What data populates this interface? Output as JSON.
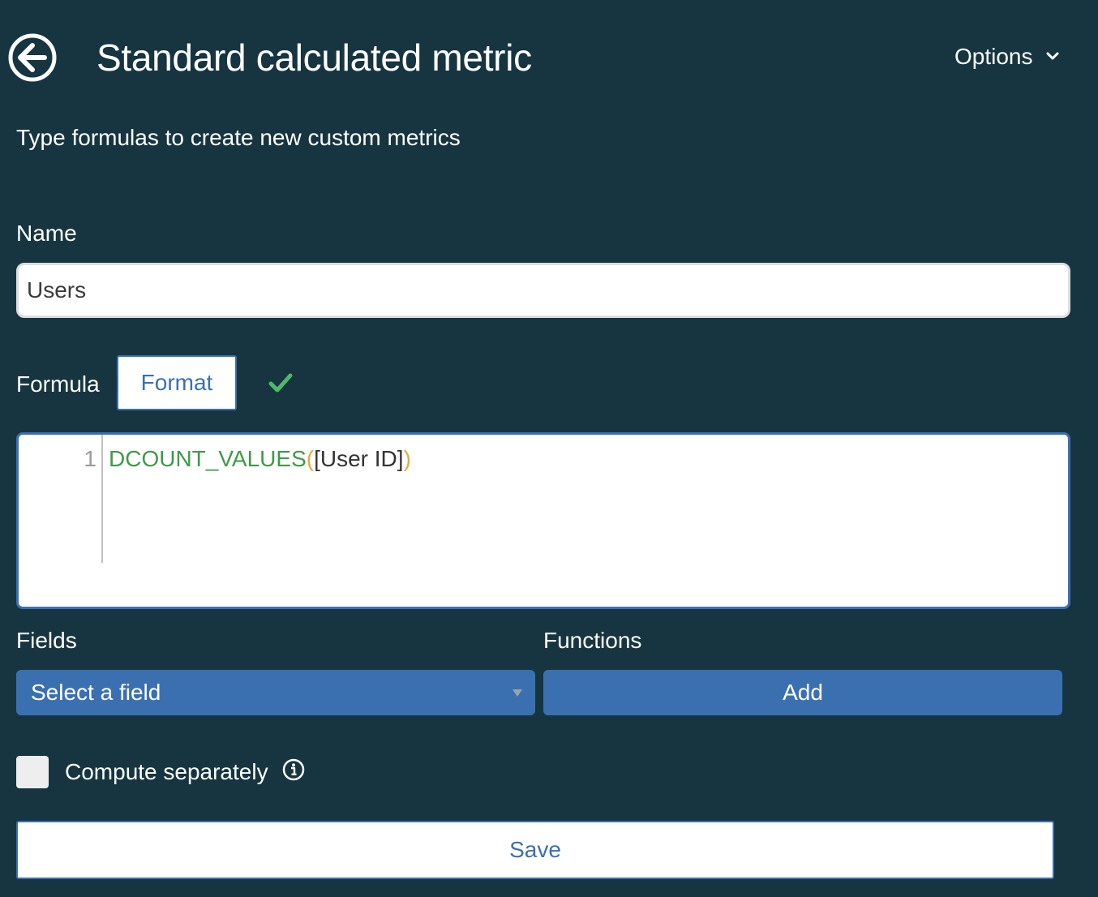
{
  "header": {
    "back_icon": "back-arrow-circle-icon",
    "title": "Standard calculated metric",
    "options_label": "Options",
    "options_icon": "chevron-down-icon"
  },
  "subtitle": "Type formulas to create new custom metrics",
  "name_section": {
    "label": "Name",
    "value": "Users"
  },
  "formula_section": {
    "label": "Formula",
    "format_button": "Format",
    "status_icon": "checkmark-icon",
    "status_color": "#4cba6a",
    "editor": {
      "line_number": "1",
      "code_function": "DCOUNT_VALUES",
      "code_open_paren": "(",
      "code_field": "[User ID]",
      "code_close_paren": ")"
    }
  },
  "fields_section": {
    "label": "Fields",
    "select_value": "Select a field"
  },
  "functions_section": {
    "label": "Functions",
    "add_button": "Add"
  },
  "compute_separately": {
    "label": "Compute separately",
    "checked": false,
    "info_icon": "info-icon"
  },
  "save_button": "Save",
  "colors": {
    "background": "#163540",
    "accent": "#3b70b0",
    "function_token": "#3f9a48",
    "paren_token": "#e8a93a"
  }
}
